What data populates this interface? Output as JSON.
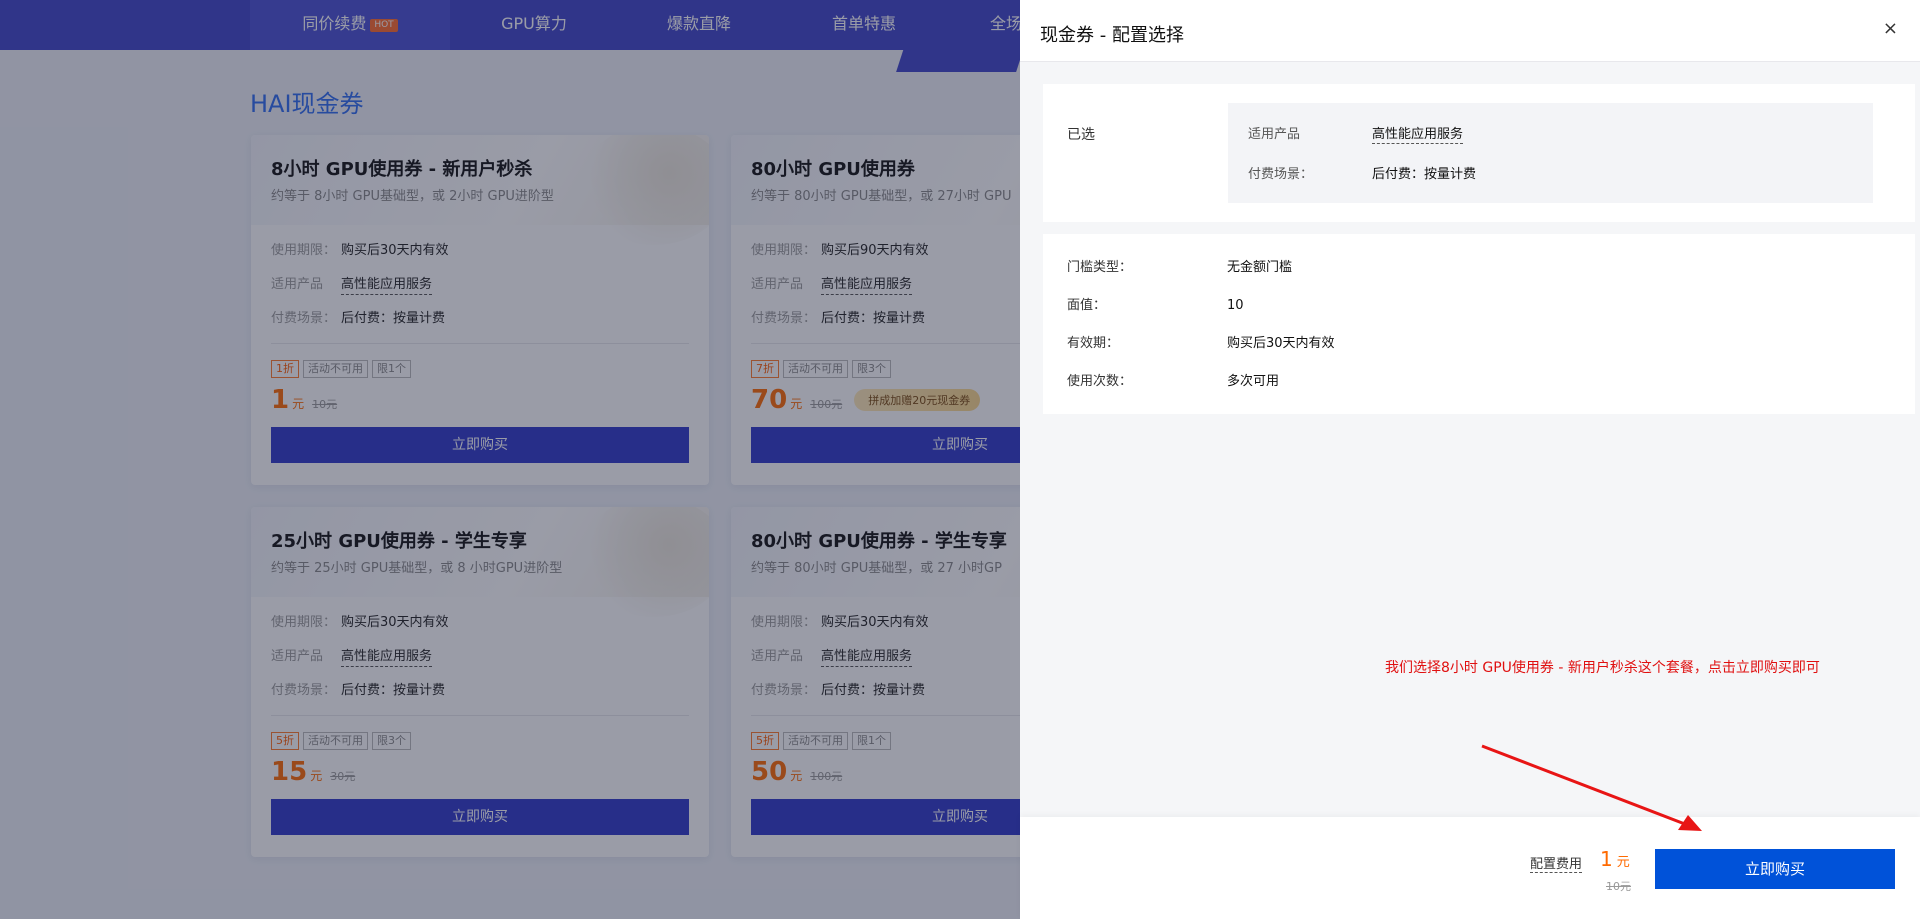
{
  "nav": {
    "items": [
      {
        "label": "同价续费",
        "badge": "HOT"
      },
      {
        "label": "GPU算力"
      },
      {
        "label": "爆款直降"
      },
      {
        "label": "首单特惠"
      },
      {
        "label": "全场"
      }
    ]
  },
  "section_title": "HAI现金券",
  "field_labels": {
    "validity": "使用期限：",
    "product": "适用产品",
    "billing": "付费场景："
  },
  "cards": [
    {
      "title": "8小时 GPU使用券 - 新用户秒杀",
      "subtitle": "约等于 8小时 GPU基础型，或 2小时 GPU进阶型",
      "validity": "购买后30天内有效",
      "product": "高性能应用服务",
      "billing": "后付费：按量计费",
      "tags": [
        "1折",
        "活动不可用",
        "限1个"
      ],
      "price": "1",
      "unit": "元",
      "original": "10元",
      "promo": "",
      "button": "立即购买"
    },
    {
      "title": "80小时 GPU使用券",
      "subtitle": "约等于 80小时 GPU基础型，或 27小时 GPU",
      "validity": "购买后90天内有效",
      "product": "高性能应用服务",
      "billing": "后付费：按量计费",
      "tags": [
        "7折",
        "活动不可用",
        "限3个"
      ],
      "price": "70",
      "unit": "元",
      "original": "100元",
      "promo": "拼成加赠20元现金券",
      "button": "立即购买"
    },
    {
      "title": "25小时 GPU使用券 - 学生专享",
      "subtitle": "约等于 25小时 GPU基础型，或 8 小时GPU进阶型",
      "validity": "购买后30天内有效",
      "product": "高性能应用服务",
      "billing": "后付费：按量计费",
      "tags": [
        "5折",
        "活动不可用",
        "限3个"
      ],
      "price": "15",
      "unit": "元",
      "original": "30元",
      "promo": "",
      "button": "立即购买"
    },
    {
      "title": "80小时 GPU使用券 - 学生专享",
      "subtitle": "约等于 80小时 GPU基础型，或 27 小时GP",
      "validity": "购买后30天内有效",
      "product": "高性能应用服务",
      "billing": "后付费：按量计费",
      "tags": [
        "5折",
        "活动不可用",
        "限1个"
      ],
      "price": "50",
      "unit": "元",
      "original": "100元",
      "promo": "",
      "button": "立即购买"
    }
  ],
  "drawer": {
    "title": "现金券 - 配置选择",
    "close": "×",
    "selected_label": "已选",
    "selected": {
      "product_label": "适用产品",
      "product_value": "高性能应用服务",
      "billing_label": "付费场景：",
      "billing_value": "后付费：按量计费"
    },
    "details": [
      {
        "label": "门槛类型：",
        "value": "无金额门槛"
      },
      {
        "label": "面值：",
        "value": "10"
      },
      {
        "label": "有效期：",
        "value": "购买后30天内有效"
      },
      {
        "label": "使用次数：",
        "value": "多次可用"
      }
    ],
    "annotation": "我们选择8小时 GPU使用券 - 新用户秒杀这个套餐，点击立即购买即可",
    "annotation_color": "#e01010",
    "footer": {
      "fee_label": "配置费用",
      "price": "1",
      "unit": "元",
      "original": "10元",
      "buy_button": "立即购买"
    }
  },
  "colors": {
    "nav_bg": "#3f44c8",
    "card_button": "#2f37c8",
    "buy_button": "#0052d9",
    "price": "#ff6a00",
    "section_title": "#2e6cf0"
  }
}
